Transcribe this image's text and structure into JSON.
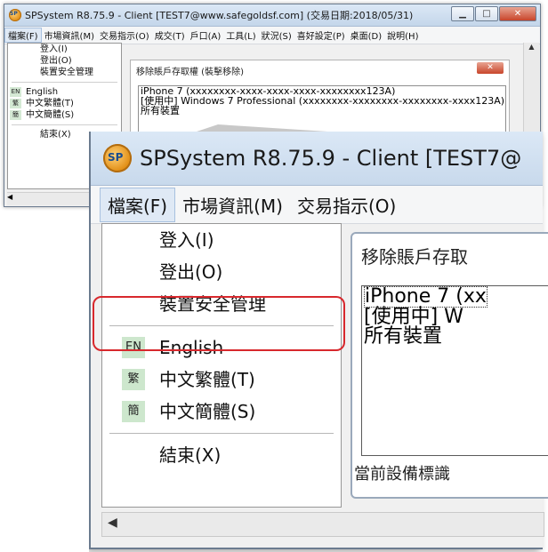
{
  "window": {
    "title": "SPSystem R8.75.9 - Client [TEST7@www.safegoldsf.com] (交易日期:2018/05/31)",
    "min_label": "▁",
    "max_label": "□",
    "close_label": "✕"
  },
  "menubar": {
    "items": [
      "檔案(F)",
      "市場資訊(M)",
      "交易指示(O)",
      "成交(T)",
      "戶口(A)",
      "工具(L)",
      "狀況(S)",
      "喜好設定(P)",
      "桌面(D)",
      "說明(H)"
    ]
  },
  "file_menu": {
    "login": "登入(I)",
    "logout": "登出(O)",
    "device_security": "裝置安全管理",
    "english": "English",
    "english_badge": "EN",
    "trad_chinese": "中文繁體(T)",
    "trad_badge": "繁",
    "simp_chinese": "中文簡體(S)",
    "simp_badge": "簡",
    "exit": "結束(X)"
  },
  "panel": {
    "title": "移除賬戶存取權 (裝擊移除)",
    "list": [
      "iPhone 7 (xxxxxxxx-xxxx-xxxx-xxxx-xxxxxxxx123A)",
      "[使用中] Windows 7 Professional (xxxxxxxx-xxxxxxxx-xxxxxxxx-xxxx123A)",
      "所有裝置"
    ]
  },
  "zoom": {
    "title": "SPSystem R8.75.9 - Client [TEST7@",
    "menubar": [
      "檔案(F)",
      "市場資訊(M)",
      "交易指示(O)"
    ],
    "panel_title": "移除賬戶存取",
    "list": [
      "iPhone 7 (xx",
      "[使用中] W",
      "所有裝置"
    ],
    "footer": "當前設備標識"
  },
  "colors": {
    "highlight": "#d8282d",
    "titlebar": "#c8d9ec",
    "lang_badge": "#cde7cd"
  }
}
